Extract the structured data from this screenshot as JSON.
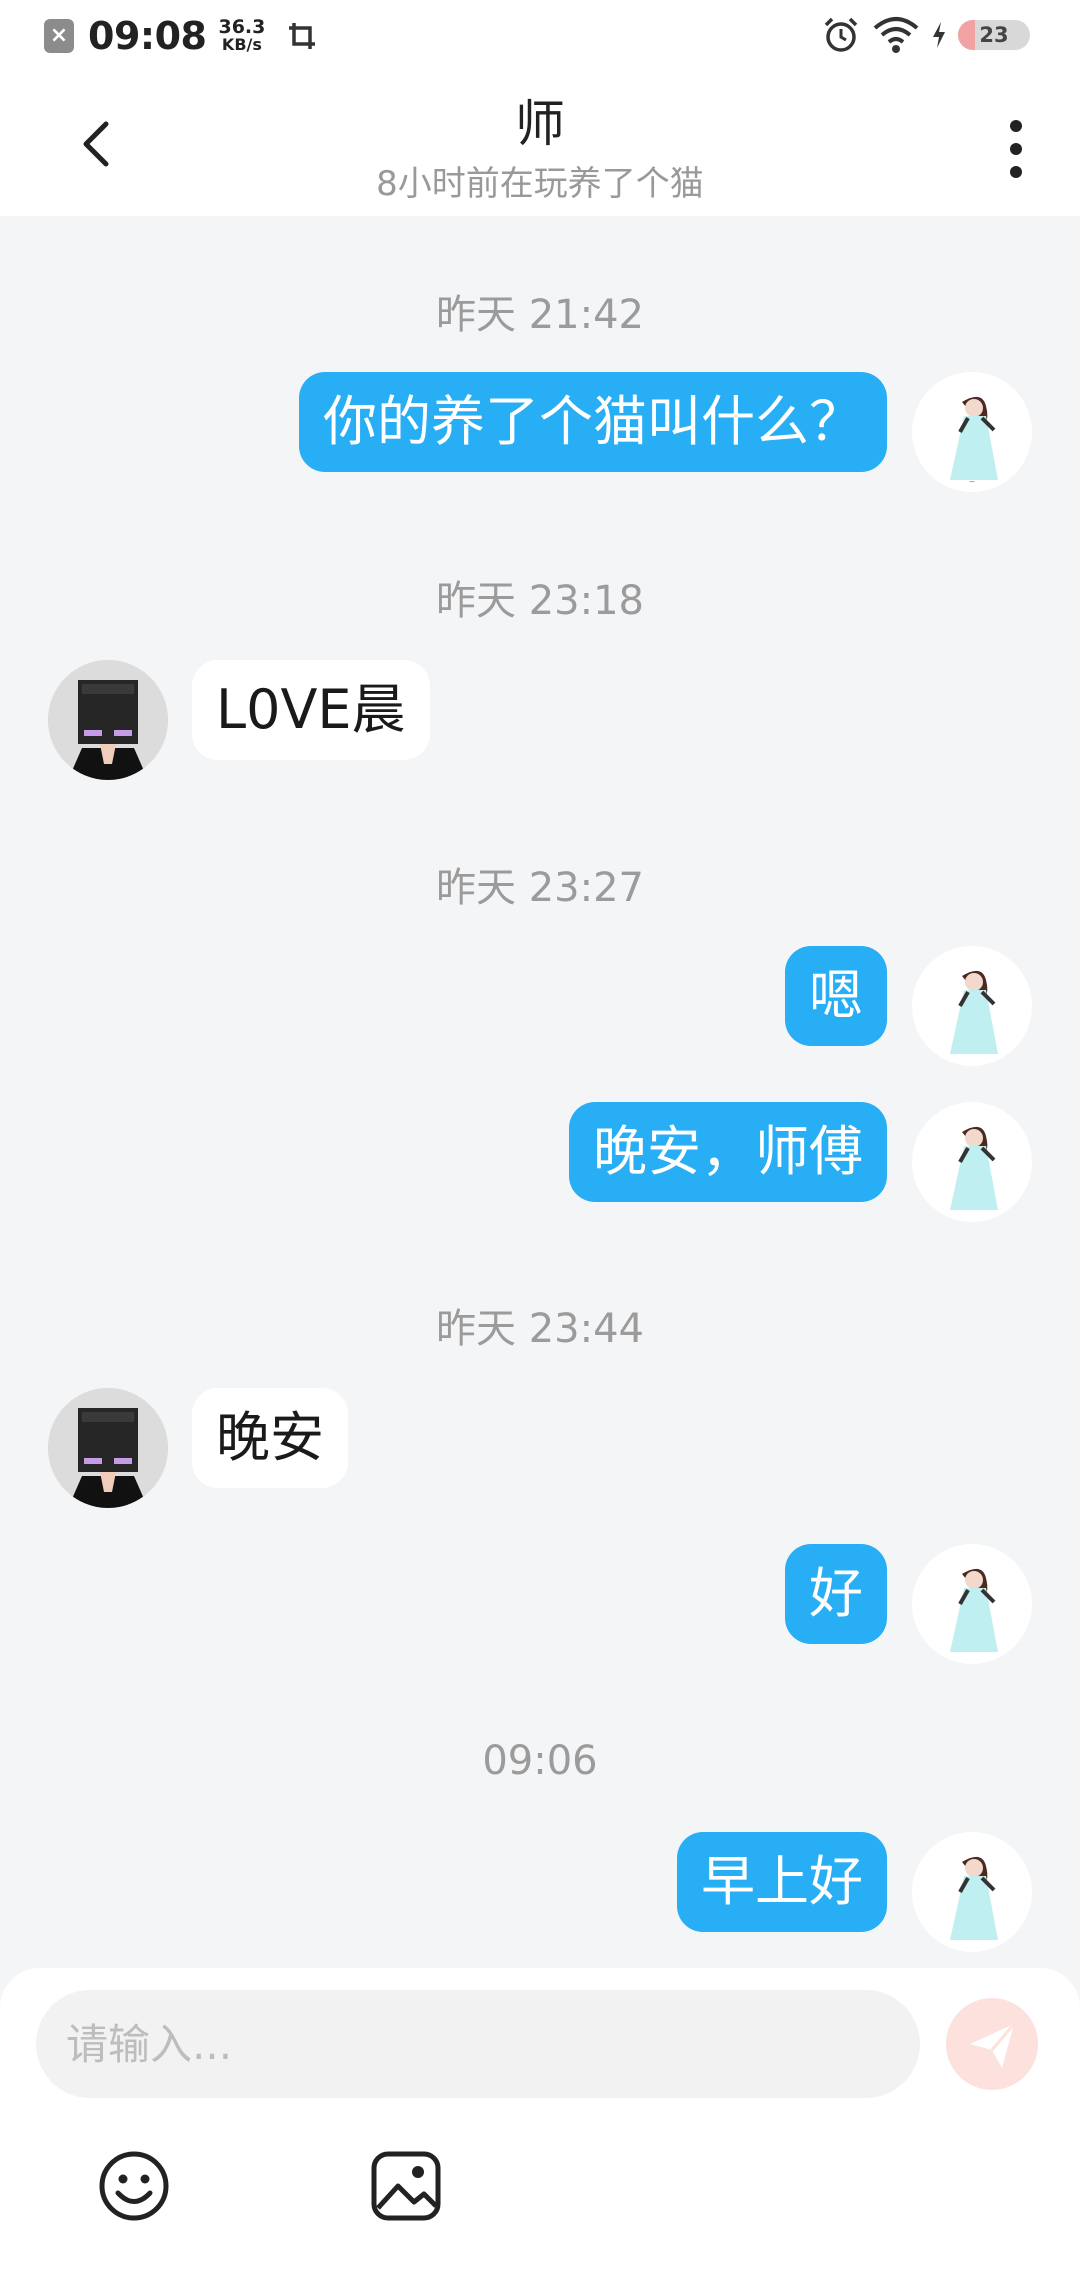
{
  "status_bar": {
    "time": "09:08",
    "speed_value": "36.3",
    "speed_unit": "KB/s",
    "battery": "23",
    "battery_level": 0.23
  },
  "header": {
    "title": "师",
    "subtitle": "8小时前在玩养了个猫"
  },
  "messages": [
    {
      "type": "time",
      "text": "昨天 21:42"
    },
    {
      "type": "me",
      "text": "你的养了个猫叫什么？"
    },
    {
      "type": "time",
      "text": "昨天 23:18"
    },
    {
      "type": "them",
      "text": "L0VE晨"
    },
    {
      "type": "time",
      "text": "昨天 23:27"
    },
    {
      "type": "me",
      "text": "嗯"
    },
    {
      "type": "me",
      "text": "晚安，师傅"
    },
    {
      "type": "time",
      "text": "昨天 23:44"
    },
    {
      "type": "them",
      "text": "晚安"
    },
    {
      "type": "me",
      "text": "好"
    },
    {
      "type": "time",
      "text": "09:06"
    },
    {
      "type": "me",
      "text": "早上好"
    }
  ],
  "composer": {
    "placeholder": "请输入...",
    "send_icon": "paper-plane-icon",
    "tools": [
      "smiley-icon",
      "image-icon"
    ]
  },
  "colors": {
    "my_bubble": "#28aef4",
    "their_bubble": "#ffffff",
    "background": "#f4f5f7"
  }
}
